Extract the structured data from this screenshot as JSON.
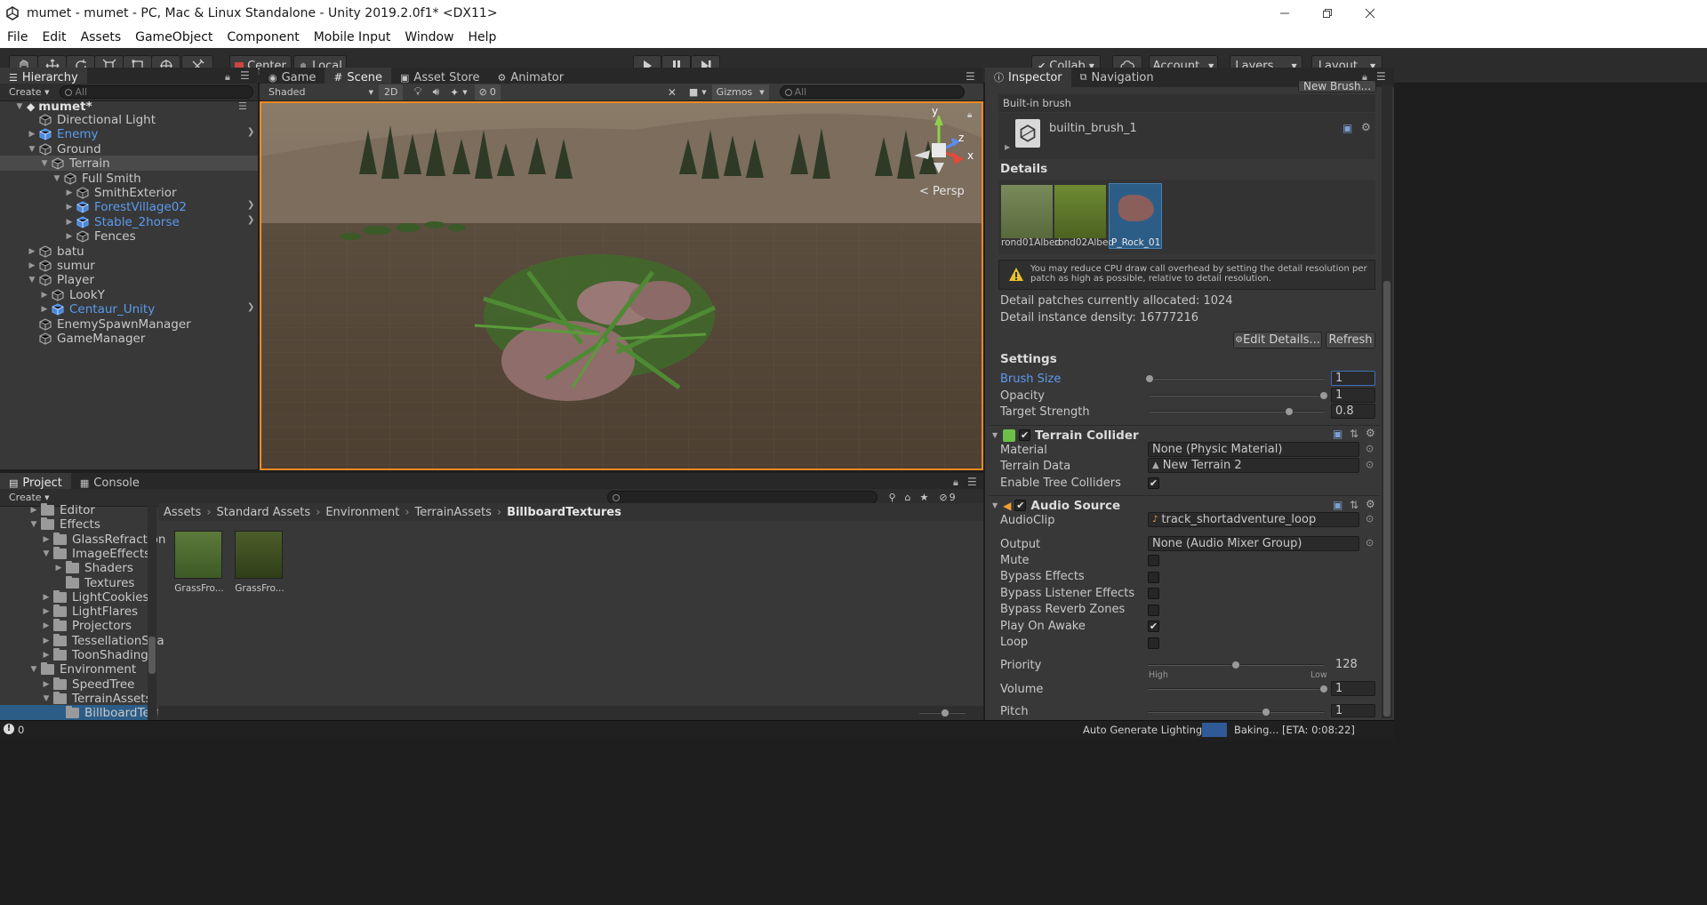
{
  "window": {
    "title": "mumet - mumet - PC, Mac & Linux Standalone - Unity 2019.2.0f1* <DX11>"
  },
  "menu": [
    "File",
    "Edit",
    "Assets",
    "GameObject",
    "Component",
    "Mobile Input",
    "Window",
    "Help"
  ],
  "toolbar": {
    "tools": [
      "hand-tool-icon",
      "move-tool-icon",
      "rotate-tool-icon",
      "scale-tool-icon",
      "rect-tool-icon",
      "transform-tool-icon",
      "custom-tool-icon"
    ],
    "pivot": "Center",
    "space": "Local",
    "collab": "Collab",
    "account": "Account",
    "layers": "Layers",
    "layout": "Layout"
  },
  "hierarchy": {
    "tab": "Hierarchy",
    "create": "Create",
    "search_placeholder": "All",
    "scene": "mumet*",
    "items": [
      {
        "label": "Directional Light",
        "depth": 1,
        "arrow": "",
        "prefab": false
      },
      {
        "label": "Enemy",
        "depth": 1,
        "arrow": "right",
        "prefab": true
      },
      {
        "label": "Ground",
        "depth": 1,
        "arrow": "down",
        "prefab": false
      },
      {
        "label": "Terrain",
        "depth": 2,
        "arrow": "down",
        "prefab": false,
        "selected": true
      },
      {
        "label": "Full Smith",
        "depth": 3,
        "arrow": "down",
        "prefab": false
      },
      {
        "label": "SmithExterior",
        "depth": 4,
        "arrow": "right",
        "prefab": false
      },
      {
        "label": "ForestVillage02",
        "depth": 4,
        "arrow": "right",
        "prefab": true
      },
      {
        "label": "Stable_2horse",
        "depth": 4,
        "arrow": "right",
        "prefab": true
      },
      {
        "label": "Fences",
        "depth": 4,
        "arrow": "right",
        "prefab": false
      },
      {
        "label": "batu",
        "depth": 1,
        "arrow": "right",
        "prefab": false
      },
      {
        "label": "sumur",
        "depth": 1,
        "arrow": "right",
        "prefab": false
      },
      {
        "label": "Player",
        "depth": 1,
        "arrow": "down",
        "prefab": false
      },
      {
        "label": "LookY",
        "depth": 2,
        "arrow": "right",
        "prefab": false
      },
      {
        "label": "Centaur_Unity",
        "depth": 2,
        "arrow": "right",
        "prefab": true
      },
      {
        "label": "EnemySpawnManager",
        "depth": 1,
        "arrow": "",
        "prefab": false
      },
      {
        "label": "GameManager",
        "depth": 1,
        "arrow": "",
        "prefab": false
      }
    ]
  },
  "scene_view": {
    "tabs": [
      "Game",
      "Scene",
      "Asset Store",
      "Animator"
    ],
    "shading": "Shaded",
    "mode_2d": "2D",
    "hidden_count": "0",
    "gizmos": "Gizmos",
    "search_placeholder": "All",
    "persp": "Persp",
    "axis_y": "y",
    "axis_z": "z",
    "axis_x": "x"
  },
  "project": {
    "tabs": [
      "Project",
      "Console"
    ],
    "create": "Create",
    "hidden_count": "9",
    "tree": [
      {
        "label": "Editor",
        "depth": 2,
        "arrow": "right"
      },
      {
        "label": "Effects",
        "depth": 2,
        "arrow": "down"
      },
      {
        "label": "GlassRefraction",
        "depth": 3,
        "arrow": "right"
      },
      {
        "label": "ImageEffects",
        "depth": 3,
        "arrow": "down"
      },
      {
        "label": "Shaders",
        "depth": 4,
        "arrow": "right"
      },
      {
        "label": "Textures",
        "depth": 4,
        "arrow": ""
      },
      {
        "label": "LightCookies",
        "depth": 3,
        "arrow": "right"
      },
      {
        "label": "LightFlares",
        "depth": 3,
        "arrow": "right"
      },
      {
        "label": "Projectors",
        "depth": 3,
        "arrow": "right"
      },
      {
        "label": "TessellationSha",
        "depth": 3,
        "arrow": "right"
      },
      {
        "label": "ToonShading",
        "depth": 3,
        "arrow": "right"
      },
      {
        "label": "Environment",
        "depth": 2,
        "arrow": "down"
      },
      {
        "label": "SpeedTree",
        "depth": 3,
        "arrow": "right"
      },
      {
        "label": "TerrainAssets",
        "depth": 3,
        "arrow": "down"
      },
      {
        "label": "BillboardText",
        "depth": 4,
        "arrow": "",
        "selected": true
      }
    ],
    "breadcrumb": [
      "Assets",
      "Standard Assets",
      "Environment",
      "TerrainAssets",
      "BillboardTextures"
    ],
    "assets": [
      "GrassFro...",
      "GrassFro..."
    ]
  },
  "inspector": {
    "tabs": [
      "Inspector",
      "Navigation"
    ],
    "new_brush": "New Brush...",
    "builtin_brush_label": "Built-in brush",
    "brush_name": "builtin_brush_1",
    "details_heading": "Details",
    "detail_items": [
      "rond01Albed",
      "rond02Albed",
      "P_Rock_01"
    ],
    "warning": "You may reduce CPU draw call overhead by setting the detail resolution per patch as high as possible, relative to detail resolution.",
    "patches": "Detail patches currently allocated: 1024",
    "density": "Detail instance density: 16777216",
    "edit_details": "Edit Details...",
    "refresh": "Refresh",
    "settings_heading": "Settings",
    "brush_size": {
      "label": "Brush Size",
      "value": "1",
      "fraction": 0.0
    },
    "opacity": {
      "label": "Opacity",
      "value": "1",
      "fraction": 1.0
    },
    "target_strength": {
      "label": "Target Strength",
      "value": "0.8",
      "fraction": 0.8
    },
    "terrain_collider": {
      "title": "Terrain Collider",
      "material_label": "Material",
      "material_value": "None (Physic Material)",
      "terrain_data_label": "Terrain Data",
      "terrain_data_value": "New Terrain 2",
      "tree_colliders_label": "Enable Tree Colliders",
      "tree_colliders": true
    },
    "audio_source": {
      "title": "Audio Source",
      "clip_label": "AudioClip",
      "clip_value": "track_shortadventure_loop",
      "output_label": "Output",
      "output_value": "None (Audio Mixer Group)",
      "checks": [
        {
          "label": "Mute",
          "checked": false
        },
        {
          "label": "Bypass Effects",
          "checked": false
        },
        {
          "label": "Bypass Listener Effects",
          "checked": false
        },
        {
          "label": "Bypass Reverb Zones",
          "checked": false
        },
        {
          "label": "Play On Awake",
          "checked": true
        },
        {
          "label": "Loop",
          "checked": false
        }
      ],
      "priority": {
        "label": "Priority",
        "value": "128",
        "fraction": 0.5
      },
      "priority_high": "High",
      "priority_low": "Low",
      "volume": {
        "label": "Volume",
        "value": "1",
        "fraction": 1.0
      },
      "pitch": {
        "label": "Pitch",
        "value": "1",
        "fraction": 0.67
      }
    }
  },
  "status": {
    "count": "0",
    "auto_lighting": "Auto Generate Lighting On",
    "baking": "Baking... [ETA: 0:08:22]"
  },
  "colors": {
    "prefab_blue": "#5b9bef",
    "selection_blue": "#2c5d87",
    "scene_border": "#f08a24",
    "field_highlight": "#3d6fb5"
  }
}
